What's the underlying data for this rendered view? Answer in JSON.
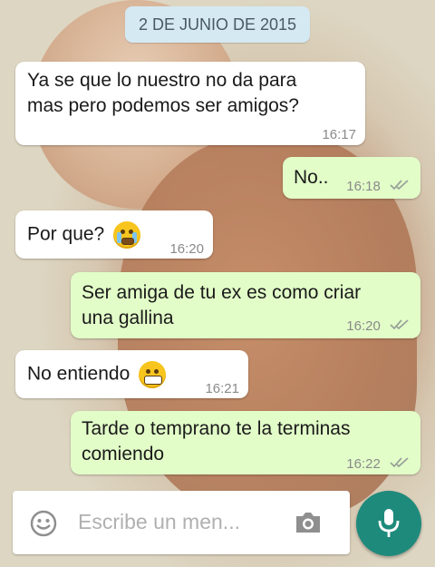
{
  "chat": {
    "date": "2 DE JUNIO DE 2015",
    "messages": [
      {
        "direction": "in",
        "text_line1": "Ya se que lo nuestro no da para",
        "text_line2": "mas pero podemos ser amigos?",
        "time": "16:17"
      },
      {
        "direction": "out",
        "text": "No..",
        "time": "16:18",
        "status": "read"
      },
      {
        "direction": "in",
        "text": "Por que?",
        "emoji": "crying-face",
        "time": "16:20"
      },
      {
        "direction": "out",
        "text_line1": "Ser amiga de tu ex es como criar",
        "text_line2": "una gallina",
        "time": "16:20",
        "status": "read"
      },
      {
        "direction": "in",
        "text": "No entiendo",
        "emoji": "grimacing-face",
        "time": "16:21"
      },
      {
        "direction": "out",
        "text_line1": "Tarde o temprano te la terminas",
        "text_line2": "comiendo",
        "time": "16:22",
        "status": "read"
      }
    ]
  },
  "composer": {
    "placeholder": "Escribe un men...",
    "icons": {
      "emoji": "smiley-icon",
      "camera": "camera-icon",
      "send": "microphone-icon"
    }
  },
  "colors": {
    "incoming_bubble": "#ffffff",
    "outgoing_bubble": "#e2fdc8",
    "date_pill": "#d5e9f2",
    "accent": "#1e8a7c",
    "read_ticks": "#9aa39a"
  }
}
